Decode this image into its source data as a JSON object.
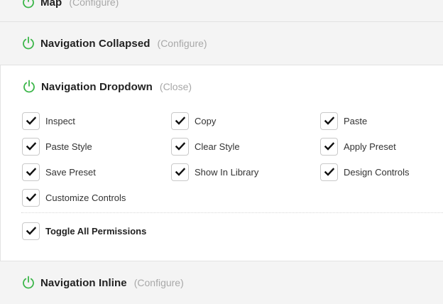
{
  "sections": {
    "map": {
      "title": "Map",
      "action": "(Configure)"
    },
    "collapsed": {
      "title": "Navigation Collapsed",
      "action": "(Configure)"
    },
    "dropdown": {
      "title": "Navigation Dropdown",
      "action": "(Close)",
      "permissions": [
        {
          "label": "Inspect",
          "checked": true
        },
        {
          "label": "Copy",
          "checked": true
        },
        {
          "label": "Paste",
          "checked": true
        },
        {
          "label": "Paste Style",
          "checked": true
        },
        {
          "label": "Clear Style",
          "checked": true
        },
        {
          "label": "Apply Preset",
          "checked": true
        },
        {
          "label": "Save Preset",
          "checked": true
        },
        {
          "label": "Show In Library",
          "checked": true
        },
        {
          "label": "Design Controls",
          "checked": true
        },
        {
          "label": "Customize Controls",
          "checked": true
        }
      ],
      "toggle_all": {
        "label": "Toggle All Permissions",
        "checked": true
      }
    },
    "inline": {
      "title": "Navigation Inline",
      "action": "(Configure)"
    }
  },
  "colors": {
    "power_icon": "#3cb64a",
    "muted_text": "#a8a8a8",
    "collapsed_bg": "#f4f4f4"
  },
  "icons": {
    "section_toggle": "power-icon",
    "checkbox_mark": "checkmark-icon"
  }
}
